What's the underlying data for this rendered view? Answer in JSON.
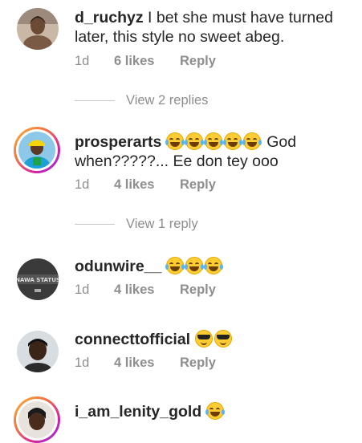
{
  "comments": [
    {
      "username": "d_ruchyz",
      "text": " I bet she must have turned later, this style no sweet abeg.",
      "time": "1d",
      "likes": "6 likes",
      "reply": "Reply",
      "view_replies": "View 2 replies"
    },
    {
      "username": "prosperarts",
      "text": " God when?????... Ee don tey ooo",
      "emoji_count": 5,
      "emoji": "face-with-tears-of-joy",
      "time": "1d",
      "likes": "4 likes",
      "reply": "Reply",
      "view_replies": "View 1 reply"
    },
    {
      "username": "odunwire__",
      "emoji_count": 3,
      "emoji": "face-with-tears-of-joy",
      "time": "1d",
      "likes": "4 likes",
      "reply": "Reply",
      "avatar_text": "NAWA STATUS"
    },
    {
      "username": "connecttofficial",
      "emoji_count": 2,
      "emoji": "smiling-face-with-sunglasses",
      "time": "1d",
      "likes": "4 likes",
      "reply": "Reply"
    },
    {
      "username": "i_am_lenity_gold",
      "emoji_count": 1,
      "emoji": "face-with-tears-of-joy"
    }
  ],
  "colors": {
    "text": "#262626",
    "secondary": "#8e8e8e",
    "story_ring": "#d6249f"
  }
}
